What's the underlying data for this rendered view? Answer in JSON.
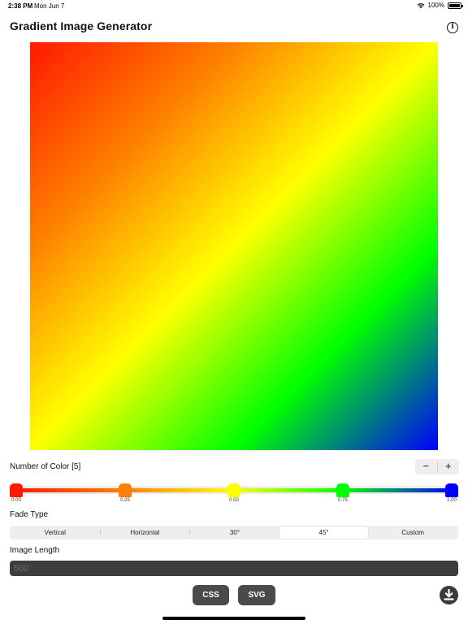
{
  "status_bar": {
    "time": "2:38 PM",
    "date": "Mon Jun 7",
    "battery": "100%"
  },
  "header": {
    "title": "Gradient Image Generator",
    "info_icon": "info-circle-icon"
  },
  "gradient": {
    "angle_deg": 45,
    "stops": [
      {
        "color": "#ff1a00",
        "position": 0.0,
        "label": "0.00"
      },
      {
        "color": "#ff7f00",
        "position": 0.25,
        "label": "0.25"
      },
      {
        "color": "#ffff00",
        "position": 0.5,
        "label": "0.50"
      },
      {
        "color": "#00ff00",
        "position": 0.75,
        "label": "0.75"
      },
      {
        "color": "#0000ff",
        "position": 1.0,
        "label": "1.00"
      }
    ]
  },
  "colors": {
    "label": "Number of Color [5]",
    "minus": "−",
    "plus": "+"
  },
  "fade": {
    "label": "Fade Type",
    "options": [
      "Vertical",
      "Horizontal",
      "30°",
      "45°",
      "Custom"
    ],
    "selected": "45°"
  },
  "length": {
    "label": "Image Length",
    "value": "",
    "placeholder": "500"
  },
  "actions": {
    "css": "CSS",
    "svg": "SVG",
    "download_icon": "download-icon"
  }
}
